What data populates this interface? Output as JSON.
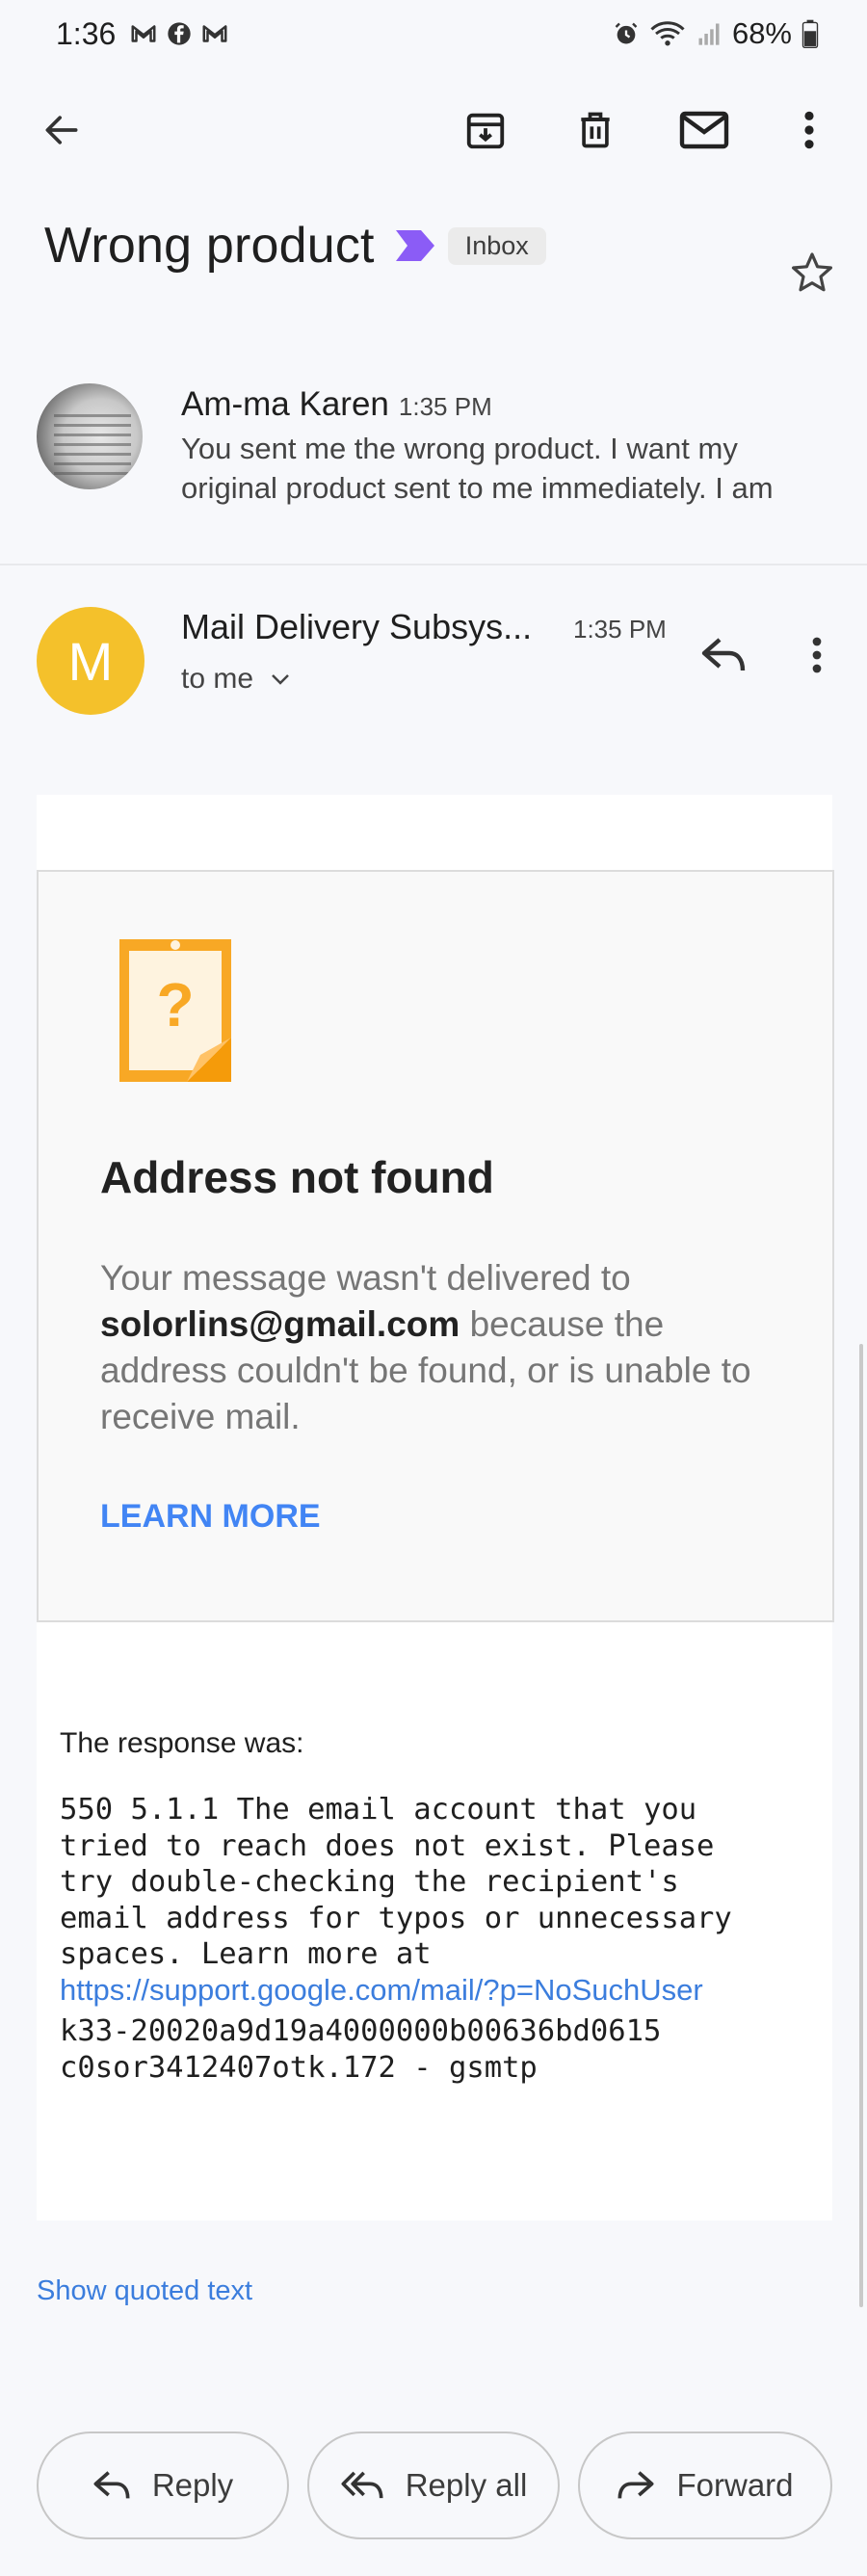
{
  "status_bar": {
    "time": "1:36",
    "battery": "68%"
  },
  "subject": {
    "title": "Wrong product",
    "label": "Inbox"
  },
  "collapsed_message": {
    "sender": "Am-ma Karen",
    "time": "1:35 PM",
    "snippet": "You sent me the wrong product. I want my original product sent to me immediately. I am"
  },
  "expanded_message": {
    "avatar_letter": "M",
    "sender": "Mail Delivery Subsys...",
    "time": "1:35 PM",
    "recipient": "to me"
  },
  "bounce": {
    "title": "Address not found",
    "msg_prefix": "Your message wasn't delivered to",
    "email": "solorlins@gmail.com",
    "msg_suffix": "because the address couldn't be found, or is unable to receive mail.",
    "learn_more": "LEARN MORE"
  },
  "response": {
    "label": "The response was:",
    "body": "550 5.1.1 The email account that you\ntried to reach does not exist. Please\ntry double-checking the recipient's\nemail address for typos or unnecessary\nspaces. Learn more at",
    "link": "https://support.google.com/mail/?p=NoSuchUser",
    "tail": "k33-20020a9d19a4000000b00636bd0615\nc0sor3412407otk.172 - gsmtp"
  },
  "show_quoted": "Show quoted text",
  "actions": {
    "reply": "Reply",
    "reply_all": "Reply all",
    "forward": "Forward"
  },
  "colors": {
    "avatar_m": "#f4c12b",
    "link": "#3b7ddd",
    "learn_more": "#4285f4",
    "label_arrow": "#8b5cf6"
  }
}
